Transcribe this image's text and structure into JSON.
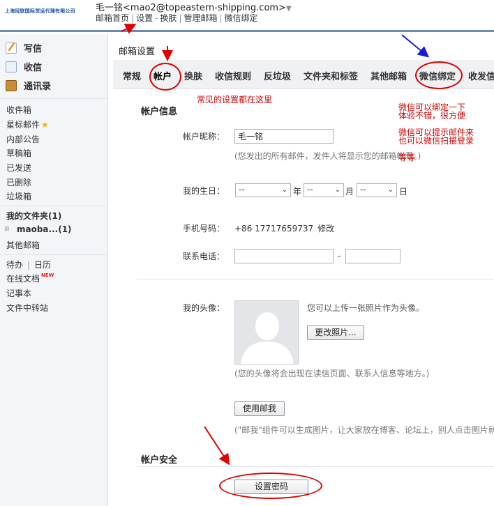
{
  "header": {
    "company": "上海冠联国际货运代理有限公司",
    "user_name": "毛一铭",
    "user_email": "<mao2@topeastern-shipping.com>",
    "caret": "▼",
    "links": [
      "邮箱首页",
      "设置",
      "换肤",
      "管理邮箱",
      "微信绑定"
    ]
  },
  "sidebar": {
    "primary": [
      {
        "label": "写信",
        "icon": "pen-icon"
      },
      {
        "label": "收信",
        "icon": "inbox-icon"
      },
      {
        "label": "通讯录",
        "icon": "contacts-icon"
      }
    ],
    "folders": [
      "收件箱",
      "星标邮件",
      "内部公告",
      "草稿箱",
      "已发送",
      "已删除",
      "垃圾箱"
    ],
    "my_folders": "我的文件夹(1)",
    "sub_folder": "maoba...(1)",
    "tree_toggle": "⊞",
    "other_mail": "其他邮箱",
    "tools": {
      "todo": "待办",
      "calendar": "日历",
      "online_docs": "在线文档",
      "new_badge": "NEW",
      "notes": "记事本",
      "transfer": "文件中转站"
    }
  },
  "content": {
    "title": "邮箱设置",
    "tabs": [
      "常规",
      "帐户",
      "换肤",
      "收信规则",
      "反垃圾",
      "文件夹和标签",
      "其他邮箱",
      "微信绑定",
      "收发信"
    ],
    "active_tab": "帐户",
    "account_info": {
      "section_title": "帐户信息",
      "nickname_label": "帐户昵称：",
      "nickname_value": "毛一铭",
      "nickname_hint": "(您发出的所有邮件，发件人将显示您的邮箱帐号。)",
      "birthday_label": "我的生日：",
      "birthday_year": "--",
      "birthday_month": "--",
      "birthday_day": "--",
      "year_unit": "年",
      "month_unit": "月",
      "day_unit": "日",
      "phone_label": "手机号码：",
      "phone_value": "+86 17717659737",
      "phone_edit": "修改",
      "tel_label": "联系电话：",
      "tel_sep": "-",
      "avatar_label": "我的头像：",
      "avatar_upload_text": "您可以上传一张照片作为头像。",
      "avatar_change_btn": "更改照片...",
      "avatar_hint": "(您的头像将会出现在读信页面、联系人信息等地方。)",
      "use_mailme_btn": "使用邮我",
      "mailme_hint": "(\"邮我\"组件可以生成图片，让大家放在博客、论坛上，别人点击图片就"
    },
    "security": {
      "section_title": "帐户安全",
      "set_password_btn": "设置密码"
    }
  },
  "annotations": {
    "common_settings": "常见的设置都在这里",
    "wechat_line1": "微信可以绑定一下",
    "wechat_line2": "体验不错，很方便",
    "wechat_line3": "微信可以提示邮件来",
    "wechat_line4": "也可以微信扫描登录",
    "wechat_line5": "等等"
  },
  "colors": {
    "annotation_red": "#e00000",
    "arrow_blue": "#1a1adc",
    "header_border": "#6a8ab5"
  }
}
